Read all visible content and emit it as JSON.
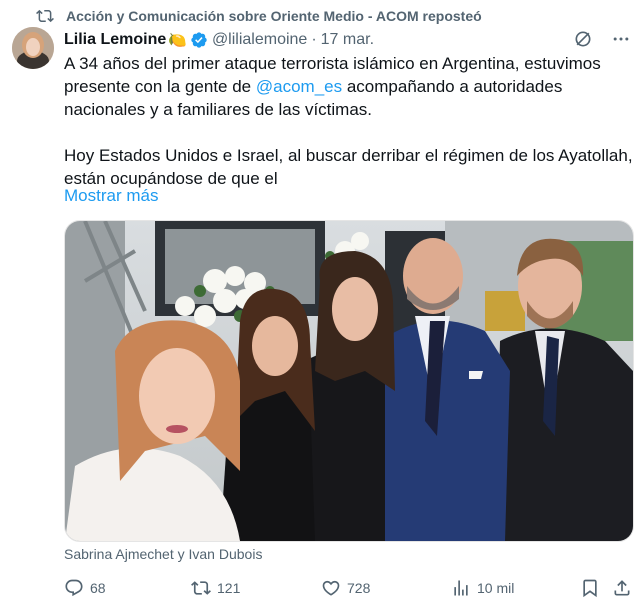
{
  "repost": {
    "text": "Acción y Comunicación sobre Oriente Medio - ACOM reposteó",
    "icon": "repost-icon"
  },
  "author": {
    "name": "Lilia Lemoine",
    "emoji": "🍋",
    "handle": "@lilialemoine",
    "separator": "·",
    "date": "17 mar.",
    "verified_color": "#1d9bf0"
  },
  "tweet": {
    "line1": "A 34 años del primer ataque terrorista islámico en Argentina, estuvimos",
    "line2_before": "presente con la gente de ",
    "mention": "@acom_es",
    "line2_after": " acompañando a autoridades",
    "line3": "nacionales y a familiares de las víctimas.",
    "line4": "Hoy Estados Unidos e Israel, al buscar derribar el régimen de los Ayatollah,",
    "line5": "están ocupándose de que el",
    "show_more": "Mostrar más"
  },
  "media": {
    "tagged_people": "Sabrina Ajmechet y Ivan Dubois"
  },
  "actions": {
    "replies": "68",
    "reposts": "121",
    "likes": "728",
    "views": "10 mil"
  },
  "colors": {
    "accent": "#1d9bf0",
    "muted": "#536471",
    "text": "#0f1419"
  }
}
